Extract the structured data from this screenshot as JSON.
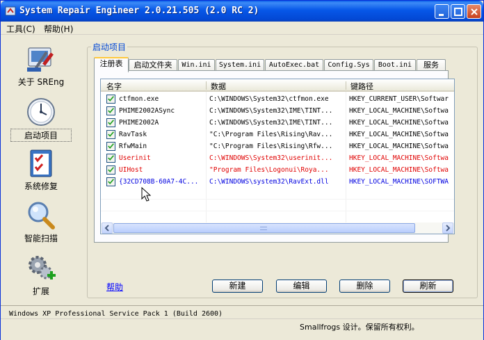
{
  "window": {
    "title": "System Repair Engineer 2.0.21.505 (2.0 RC 2)"
  },
  "menu": [
    {
      "label": "工具(C)"
    },
    {
      "label": "帮助(H)"
    }
  ],
  "nav": [
    {
      "label": "关于 SREng",
      "icon": "toolbox-icon"
    },
    {
      "label": "启动项目",
      "icon": "clock-icon",
      "selected": true
    },
    {
      "label": "系统修复",
      "icon": "checklist-icon"
    },
    {
      "label": "智能扫描",
      "icon": "magnifier-icon"
    },
    {
      "label": "扩展",
      "icon": "gears-plus-icon"
    }
  ],
  "group_title": "启动项目",
  "tabs": [
    {
      "label": "注册表",
      "active": true
    },
    {
      "label": "启动文件夹"
    },
    {
      "label": "Win.ini"
    },
    {
      "label": "System.ini"
    },
    {
      "label": "AutoExec.bat"
    },
    {
      "label": "Config.Sys"
    },
    {
      "label": "Boot.ini"
    },
    {
      "label": "服务"
    }
  ],
  "list": {
    "columns": [
      "名字",
      "数据",
      "键路径"
    ],
    "rows": [
      {
        "name": "ctfmon.exe",
        "data": "C:\\WINDOWS\\System32\\ctfmon.exe",
        "key": "HKEY_CURRENT_USER\\Softwar",
        "checked": true,
        "color": "#000000"
      },
      {
        "name": "PHIME2002ASync",
        "data": "C:\\WINDOWS\\System32\\IME\\TINT...",
        "key": "HKEY_LOCAL_MACHINE\\Softwa",
        "checked": true,
        "color": "#000000"
      },
      {
        "name": "PHIME2002A",
        "data": "C:\\WINDOWS\\System32\\IME\\TINT...",
        "key": "HKEY_LOCAL_MACHINE\\Softwa",
        "checked": true,
        "color": "#000000"
      },
      {
        "name": "RavTask",
        "data": "\"C:\\Program Files\\Rising\\Rav...",
        "key": "HKEY_LOCAL_MACHINE\\Softwa",
        "checked": true,
        "color": "#000000"
      },
      {
        "name": "RfwMain",
        "data": "\"C:\\Program Files\\Rising\\Rfw...",
        "key": "HKEY_LOCAL_MACHINE\\Softwa",
        "checked": true,
        "color": "#000000"
      },
      {
        "name": "Userinit",
        "data": "C:\\WINDOWS\\System32\\userinit...",
        "key": "HKEY_LOCAL_MACHINE\\Softwa",
        "checked": true,
        "color": "#e00000"
      },
      {
        "name": "UIHost",
        "data": "\"Program Files\\Logonui\\Roya...",
        "key": "HKEY_LOCAL_MACHINE\\Softwa",
        "checked": true,
        "color": "#e00000"
      },
      {
        "name": "{32CD708B-60A7-4C...",
        "data": "C:\\WINDOWS\\system32\\RavExt.dll",
        "key": "HKEY_LOCAL_MACHINE\\SOFTWA",
        "checked": true,
        "color": "#0000e0"
      }
    ]
  },
  "help_link": "帮助",
  "buttons": {
    "new": "新建",
    "edit": "编辑",
    "delete": "删除",
    "refresh": "刷新"
  },
  "status": {
    "os": "Windows XP Professional Service Pack 1 (Build 2600)",
    "copyright": "Smallfrogs 设计。保留所有权利。"
  },
  "colors": {
    "title_blue": "#0757e8",
    "group_title": "#0046d5",
    "warning_red": "#e00000",
    "module_blue": "#0000e0",
    "check_green": "#21a121"
  }
}
